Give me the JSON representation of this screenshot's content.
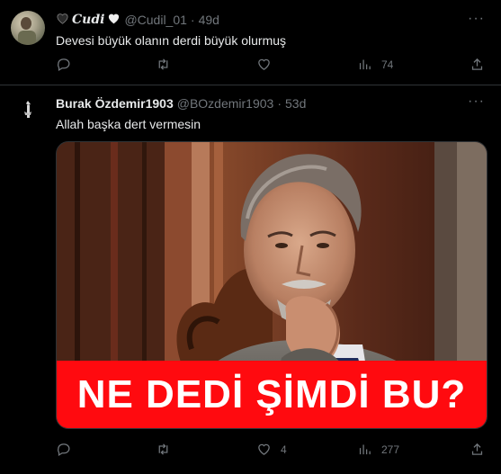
{
  "tweets": [
    {
      "name_prefix_icon": "black-heart-icon",
      "name": "Cudi",
      "name_suffix_icon": "white-heart-icon",
      "handle": "@Cudil_01",
      "time": "49d",
      "text": "Devesi büyük olanın derdi büyük olurmuş",
      "reply_count": "",
      "retweet_count": "",
      "like_count": "",
      "view_count": "74"
    },
    {
      "name": "Burak Özdemir1903",
      "handle": "@BOzdemir1903",
      "time": "53d",
      "text": "Allah başka dert vermesin",
      "media_caption": "NE DEDİ ŞİMDİ BU?",
      "reply_count": "",
      "retweet_count": "",
      "like_count": "4",
      "view_count": "277"
    }
  ],
  "more_glyph": "···",
  "colors": {
    "background": "#000000",
    "text": "#e7e9ea",
    "muted": "#71767b",
    "divider": "#2f3336",
    "banner": "#ff0a0f"
  }
}
